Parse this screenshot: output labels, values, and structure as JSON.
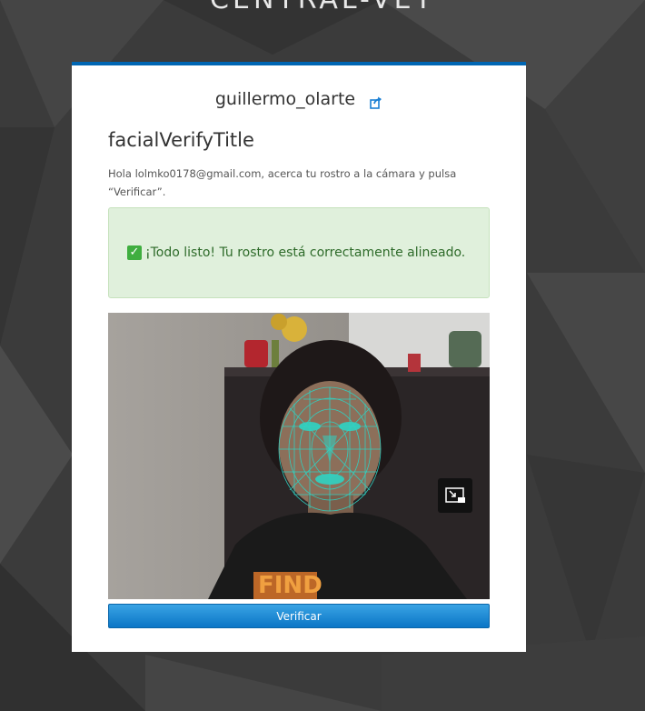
{
  "realm": {
    "title": "CENTRAL-VEY"
  },
  "header": {
    "username": "guillermo_olarte"
  },
  "page": {
    "title": "facialVerifyTitle",
    "instructions": "Hola lolmko0178@gmail.com, acerca tu rostro a la cámara y pulsa “Verificar”."
  },
  "alert": {
    "icon": "check-icon",
    "message": "¡Todo listo! Tu rostro está correctamente alineado."
  },
  "camera": {
    "pip_icon": "picture-in-picture-exit-icon",
    "shirt_text": "FIND"
  },
  "actions": {
    "verify_label": "Verificar"
  },
  "colors": {
    "accent": "#0066b3",
    "success_bg": "#e0f0dc",
    "success_text": "#2e6b2a",
    "mesh": "#2fd3c3"
  }
}
